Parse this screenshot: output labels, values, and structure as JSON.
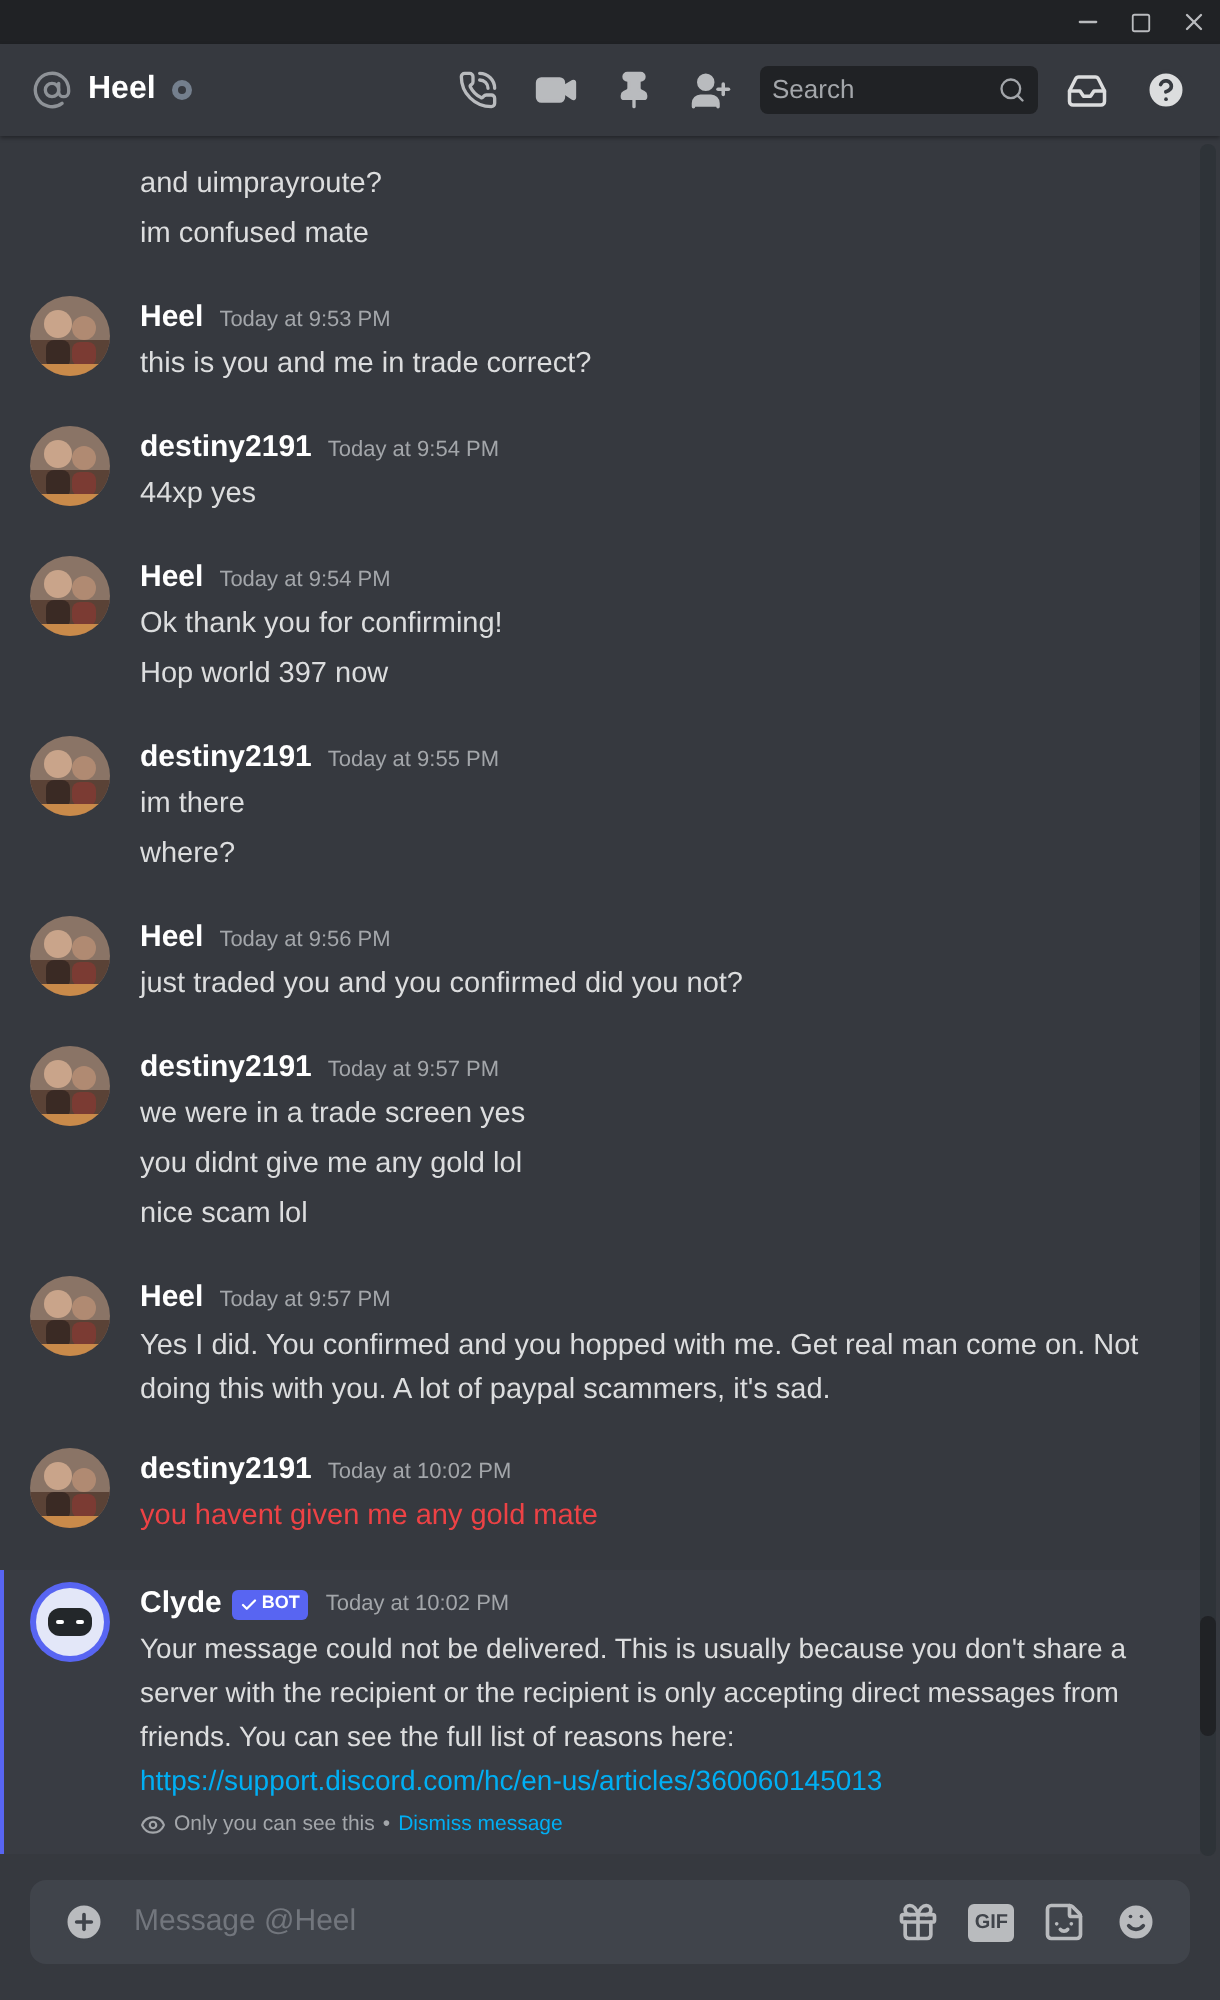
{
  "header": {
    "channel": "Heel",
    "search_placeholder": "Search"
  },
  "messages": [
    {
      "kind": "continuation",
      "lines": [
        {
          "text": "and uimprayroute?",
          "failed": false
        },
        {
          "text": "im confused mate",
          "failed": false
        }
      ]
    },
    {
      "kind": "user",
      "author": "Heel",
      "time": "Today at 9:53 PM",
      "lines": [
        {
          "text": "this is you and me in trade correct?",
          "failed": false
        }
      ]
    },
    {
      "kind": "user",
      "author": "destiny2191",
      "time": "Today at 9:54 PM",
      "lines": [
        {
          "text": "44xp yes",
          "failed": false
        }
      ]
    },
    {
      "kind": "user",
      "author": "Heel",
      "time": "Today at 9:54 PM",
      "lines": [
        {
          "text": "Ok thank you for confirming!",
          "failed": false
        },
        {
          "text": "Hop world 397 now",
          "failed": false
        }
      ]
    },
    {
      "kind": "user",
      "author": "destiny2191",
      "time": "Today at 9:55 PM",
      "lines": [
        {
          "text": "im there",
          "failed": false
        },
        {
          "text": "where?",
          "failed": false
        }
      ]
    },
    {
      "kind": "user",
      "author": "Heel",
      "time": "Today at 9:56 PM",
      "lines": [
        {
          "text": "just traded you and you confirmed did you not?",
          "failed": false
        }
      ]
    },
    {
      "kind": "user",
      "author": "destiny2191",
      "time": "Today at 9:57 PM",
      "lines": [
        {
          "text": "we were in a trade screen yes",
          "failed": false
        },
        {
          "text": "you didnt give me any gold lol",
          "failed": false
        },
        {
          "text": "nice scam lol",
          "failed": false
        }
      ]
    },
    {
      "kind": "user",
      "author": "Heel",
      "time": "Today at 9:57 PM",
      "lines": [
        {
          "text": "Yes I did. You confirmed and you hopped with me. Get real man come on. Not doing this with you. A lot of paypal scammers, it's sad.",
          "failed": false
        }
      ]
    },
    {
      "kind": "user",
      "author": "destiny2191",
      "time": "Today at 10:02 PM",
      "lines": [
        {
          "text": "you havent given me any gold mate",
          "failed": true
        }
      ]
    },
    {
      "kind": "bot",
      "author": "Clyde",
      "badge": "BOT",
      "time": "Today at 10:02 PM",
      "text": "Your message could not be delivered. This is usually because you don't share a server with the recipient or the recipient is only accepting direct messages from friends. You can see the full list of reasons here:",
      "link": "https://support.discord.com/hc/en-us/articles/360060145013",
      "notice": "Only you can see this",
      "separator": "•",
      "dismiss": "Dismiss message"
    }
  ],
  "composer": {
    "placeholder": "Message @Heel",
    "gif": "GIF"
  }
}
